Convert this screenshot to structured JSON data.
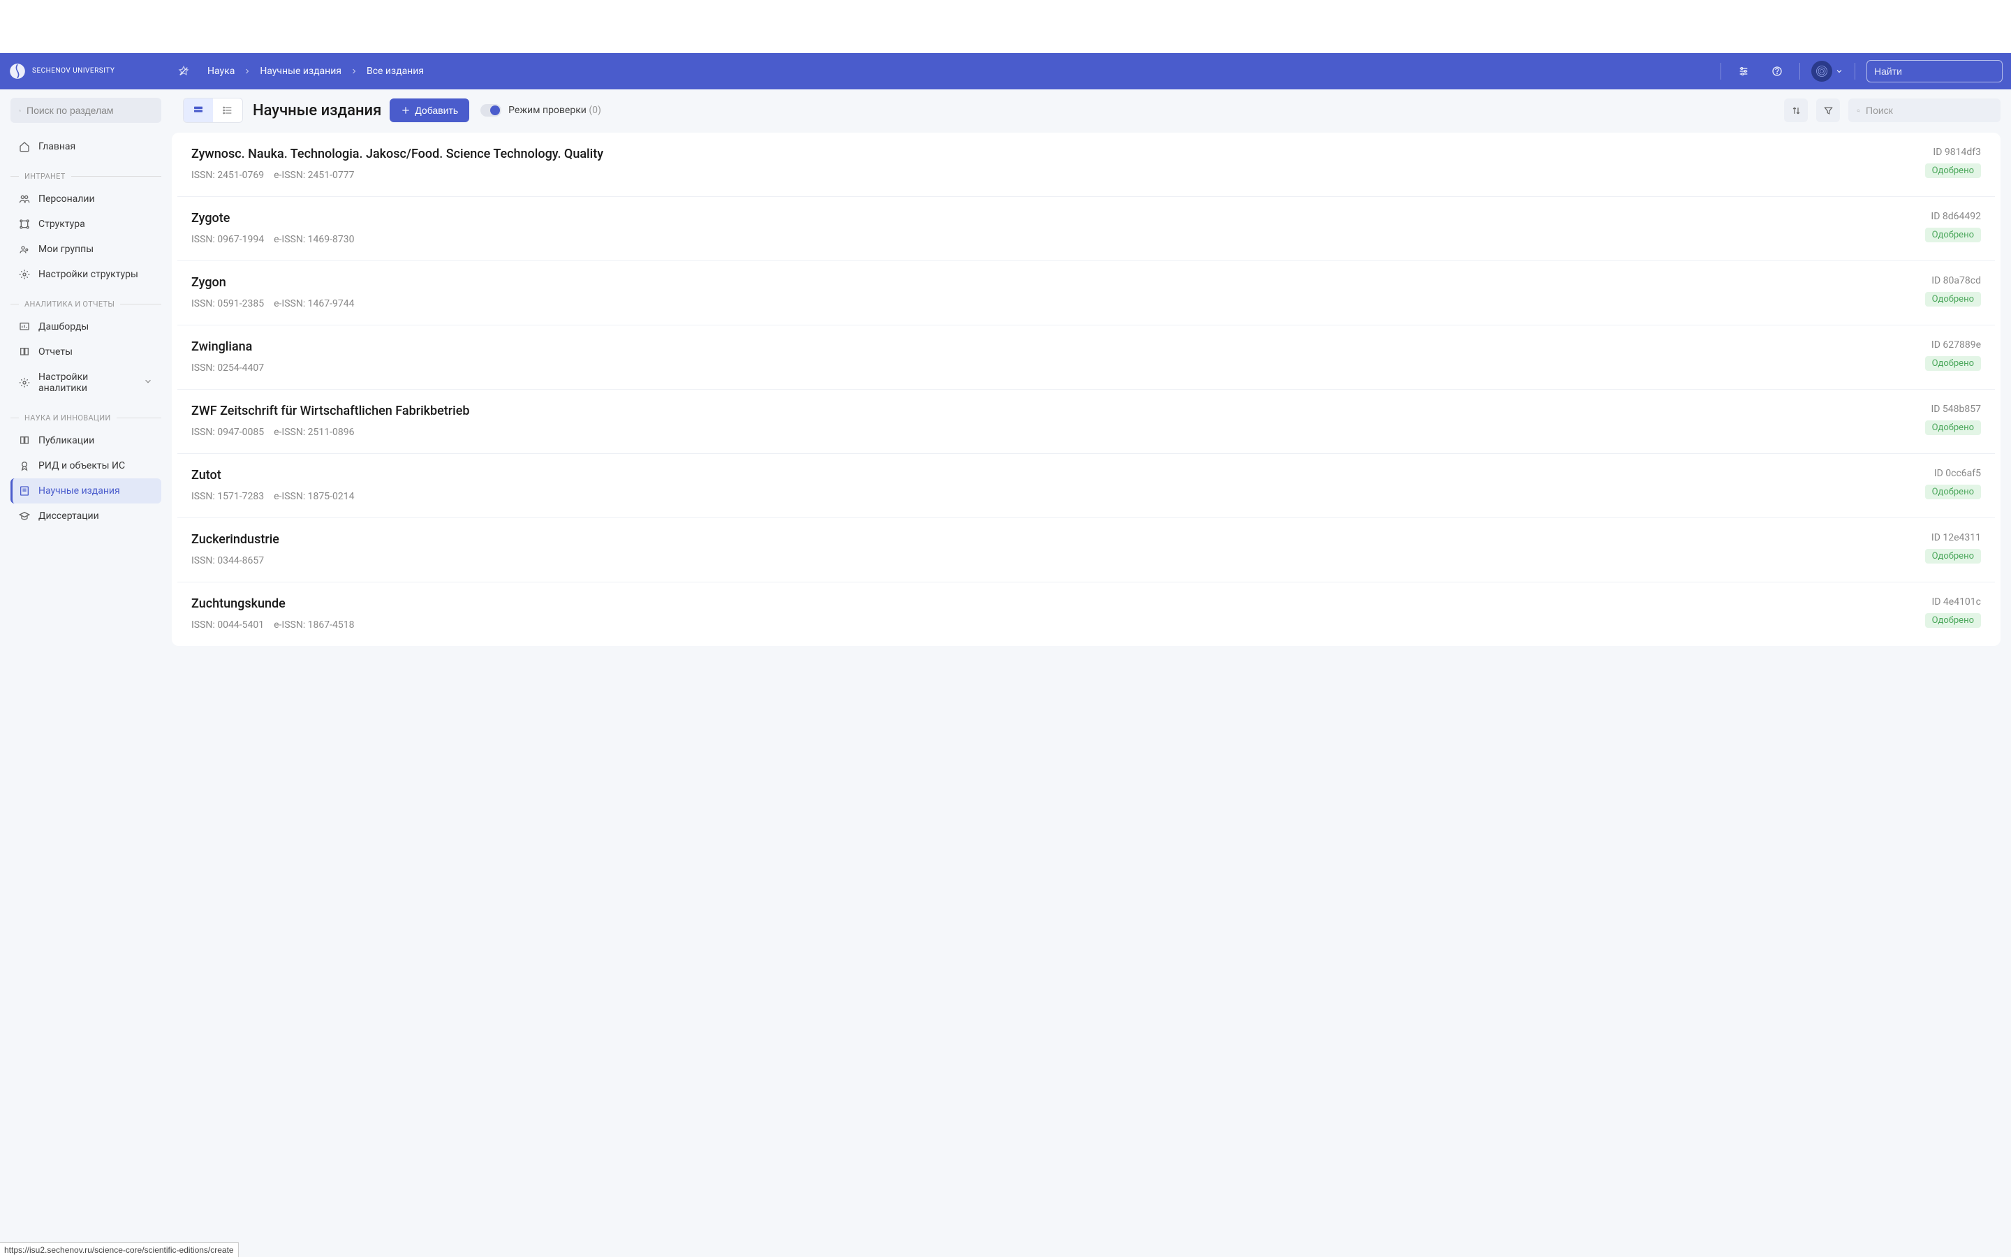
{
  "header": {
    "logo_text": "Sechenov\nUniversity",
    "breadcrumb": [
      "Наука",
      "Научные издания",
      "Все издания"
    ],
    "search_placeholder": "Найти"
  },
  "sidebar": {
    "search_placeholder": "Поиск по разделам",
    "home": "Главная",
    "sections": [
      {
        "title": "ИНТРАНЕТ",
        "items": [
          "Персоналии",
          "Структура",
          "Мои группы",
          "Настройки структуры"
        ]
      },
      {
        "title": "АНАЛИТИКА И ОТЧЕТЫ",
        "items": [
          "Дашборды",
          "Отчеты",
          "Настройки аналитики"
        ]
      },
      {
        "title": "НАУКА И ИННОВАЦИИ",
        "items": [
          "Публикации",
          "РИД и объекты ИС",
          "Научные издания",
          "Диссертации"
        ]
      }
    ]
  },
  "toolbar": {
    "title": "Научные издания",
    "add_label": "Добавить",
    "check_mode_label": "Режим проверки",
    "check_mode_count": "(0)",
    "search_placeholder": "Поиск"
  },
  "rows": [
    {
      "title": "Zywnosc. Nauka. Technologia. Jakosc/Food. Science Technology. Quality",
      "issn": "ISSN: 2451-0769",
      "eissn": "e-ISSN: 2451-0777",
      "id": "ID 9814df3",
      "status": "Одобрено"
    },
    {
      "title": "Zygote",
      "issn": "ISSN: 0967-1994",
      "eissn": "e-ISSN: 1469-8730",
      "id": "ID 8d64492",
      "status": "Одобрено"
    },
    {
      "title": "Zygon",
      "issn": "ISSN: 0591-2385",
      "eissn": "e-ISSN: 1467-9744",
      "id": "ID 80a78cd",
      "status": "Одобрено"
    },
    {
      "title": "Zwingliana",
      "issn": "ISSN: 0254-4407",
      "eissn": "",
      "id": "ID 627889e",
      "status": "Одобрено"
    },
    {
      "title": "ZWF Zeitschrift für Wirtschaftlichen Fabrikbetrieb",
      "issn": "ISSN: 0947-0085",
      "eissn": "e-ISSN: 2511-0896",
      "id": "ID 548b857",
      "status": "Одобрено"
    },
    {
      "title": "Zutot",
      "issn": "ISSN: 1571-7283",
      "eissn": "e-ISSN: 1875-0214",
      "id": "ID 0cc6af5",
      "status": "Одобрено"
    },
    {
      "title": "Zuckerindustrie",
      "issn": "ISSN: 0344-8657",
      "eissn": "",
      "id": "ID 12e4311",
      "status": "Одобрено"
    },
    {
      "title": "Zuchtungskunde",
      "issn": "ISSN: 0044-5401",
      "eissn": "e-ISSN: 1867-4518",
      "id": "ID 4e4101c",
      "status": "Одобрено"
    }
  ],
  "status_url": "https://isu2.sechenov.ru/science-core/scientific-editions/create"
}
